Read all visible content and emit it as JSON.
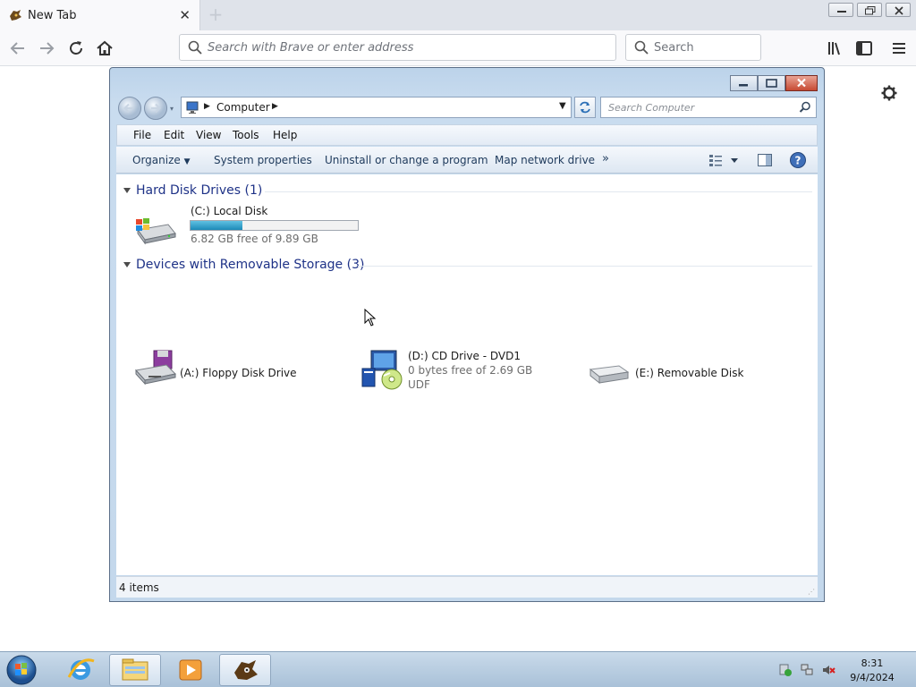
{
  "browser": {
    "tab_title": "New Tab",
    "url_placeholder": "Search with Brave or enter address",
    "search_placeholder": "Search"
  },
  "explorer": {
    "breadcrumb": "Computer",
    "search_placeholder": "Search Computer",
    "menu": [
      "File",
      "Edit",
      "View",
      "Tools",
      "Help"
    ],
    "commands": {
      "organize": "Organize",
      "system_properties": "System properties",
      "uninstall": "Uninstall or change a program",
      "map_drive": "Map network drive",
      "more": "»"
    },
    "groups": {
      "hdd": "Hard Disk Drives (1)",
      "removable": "Devices with Removable Storage (3)"
    },
    "drives": {
      "c_name": "(C:) Local Disk",
      "c_free": "6.82 GB free of 9.89 GB",
      "c_used_fraction": 0.31,
      "a_name": "(A:) Floppy Disk Drive",
      "d_name": "(D:) CD Drive - DVD1",
      "d_free": "0 bytes free of 2.69 GB",
      "d_fs": "UDF",
      "e_name": "(E:) Removable Disk"
    },
    "status": "4 items"
  },
  "taskbar": {
    "time": "8:31",
    "date": "9/4/2024"
  },
  "colors": {
    "accent_link": "#1e3287",
    "usage_fill": "#1c8ab8"
  }
}
